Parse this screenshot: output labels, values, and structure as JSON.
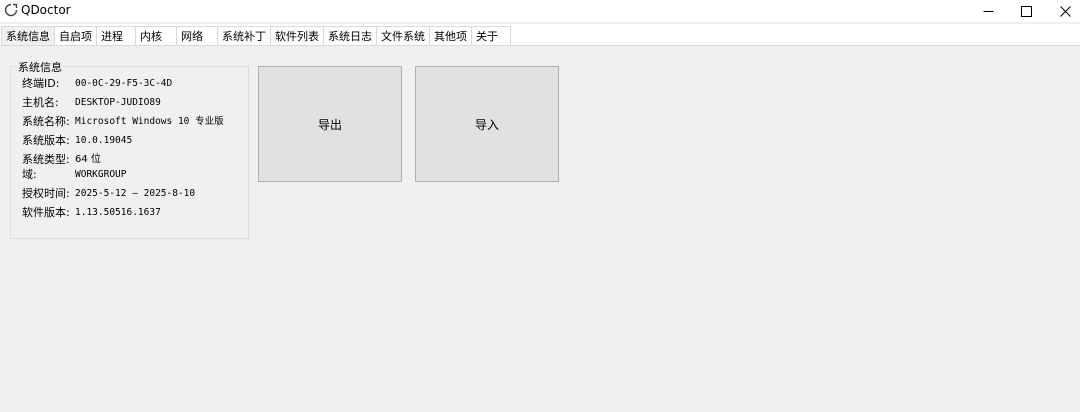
{
  "window": {
    "title": "QDoctor",
    "controls": {
      "minimize": "—",
      "maximize": "☐",
      "close": "✕"
    }
  },
  "tabs": [
    {
      "label": "系统信息",
      "active": true
    },
    {
      "label": "自启项"
    },
    {
      "label": "进程"
    },
    {
      "label": "内核"
    },
    {
      "label": "网络"
    },
    {
      "label": "系统补丁"
    },
    {
      "label": "软件列表"
    },
    {
      "label": "系统日志"
    },
    {
      "label": "文件系统"
    },
    {
      "label": "其他项"
    },
    {
      "label": "关于"
    }
  ],
  "sysinfo": {
    "group_title": "系统信息",
    "rows": [
      {
        "label": "终端ID:",
        "value": "00-0C-29-F5-3C-4D"
      },
      {
        "label": "主机名:",
        "value": "DESKTOP-JUDIO89"
      },
      {
        "label": "系统名称:",
        "value": "Microsoft Windows 10 专业版"
      },
      {
        "label": "系统版本:",
        "value": "10.0.19045"
      },
      {
        "label": "系统类型:",
        "value": "64 位"
      },
      {
        "label": "域:",
        "value": "WORKGROUP"
      },
      {
        "label": "授权时间:",
        "value": "2025-5-12 — 2025-8-10"
      },
      {
        "label": "软件版本:",
        "value": "1.13.50516.1637"
      }
    ]
  },
  "actions": {
    "export_label": "导出",
    "import_label": "导入"
  },
  "colors": {
    "background": "#f0f0f0",
    "button_face": "#e1e1e1",
    "button_border": "#adadad"
  }
}
